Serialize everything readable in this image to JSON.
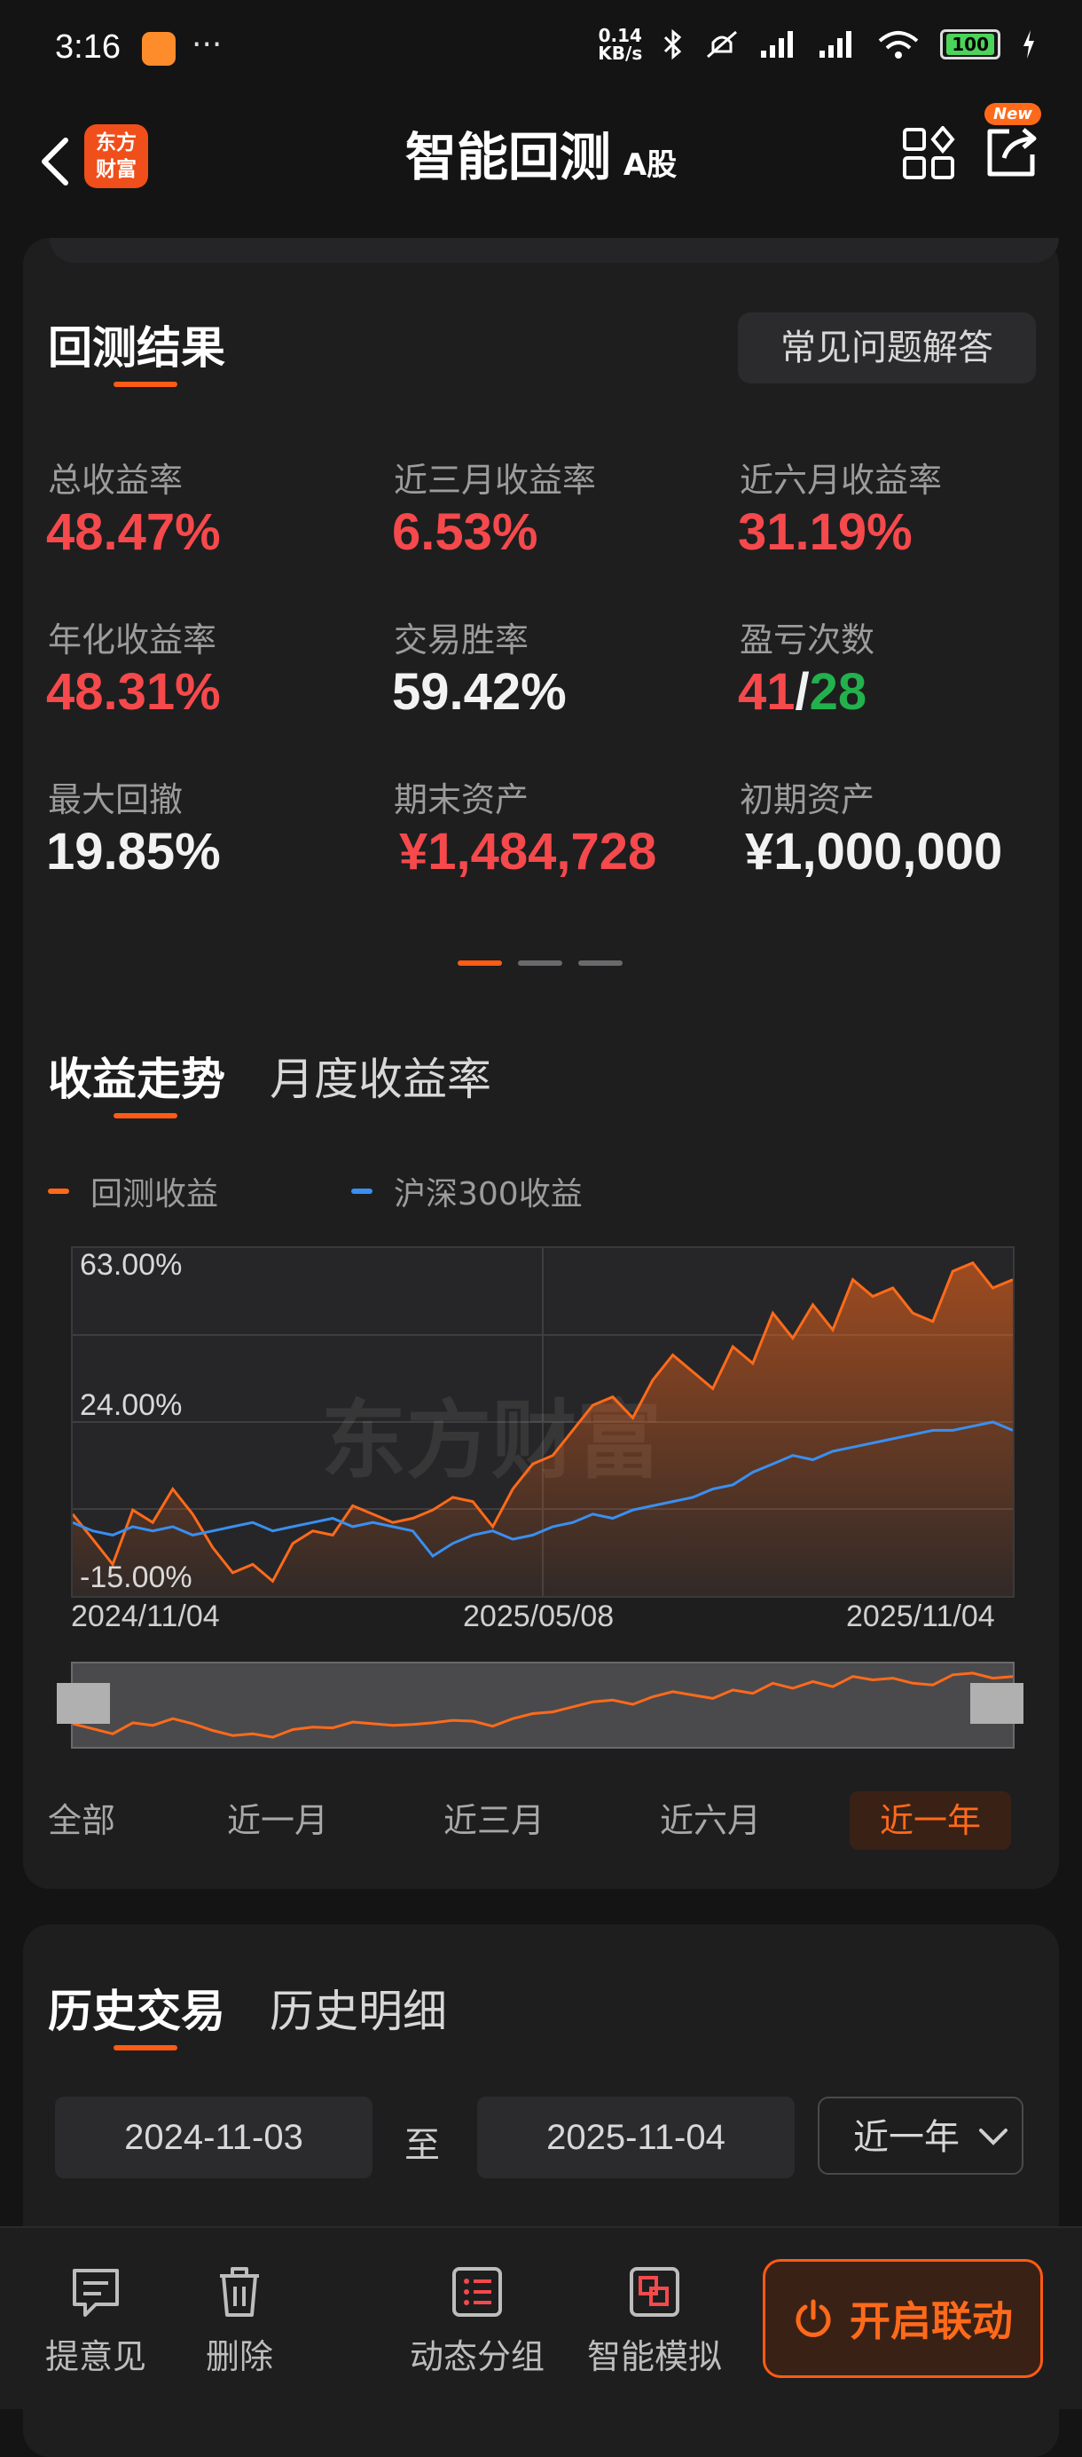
{
  "status": {
    "time": "3:16",
    "dots": "···",
    "net_speed_top": "0.14",
    "net_speed_bottom": "KB/s",
    "battery": "100"
  },
  "header": {
    "title": "智能回测",
    "market": "A股",
    "logo_line1": "东方",
    "logo_line2": "财富",
    "new_badge": "New"
  },
  "results": {
    "title": "回测结果",
    "faq_button": "常见问题解答",
    "metrics": [
      {
        "label": "总收益率",
        "value": "48.47%"
      },
      {
        "label": "近三月收益率",
        "value": "6.53%"
      },
      {
        "label": "近六月收益率",
        "value": "31.19%"
      },
      {
        "label": "年化收益率",
        "value": "48.31%"
      },
      {
        "label": "交易胜率",
        "value": "59.42%"
      },
      {
        "label": "盈亏次数",
        "wins": "41",
        "sep": "/",
        "losses": "28"
      },
      {
        "label": "最大回撤",
        "value": "19.85%"
      },
      {
        "label": "期末资产",
        "value": "¥1,484,728"
      },
      {
        "label": "初期资产",
        "value": "¥1,000,000"
      }
    ]
  },
  "trend": {
    "tab_active": "收益走势",
    "tab_other": "月度收益率",
    "legend": [
      {
        "name": "回测收益",
        "color": "#ff6a1a"
      },
      {
        "name": "沪深300收益",
        "color": "#3a8ff0"
      }
    ],
    "watermark": "东方财富",
    "ranges": [
      "全部",
      "近一月",
      "近三月",
      "近六月",
      "近一年"
    ],
    "active_range": "近一年"
  },
  "chart_data": {
    "type": "line",
    "yticks": [
      "63.00%",
      "24.00%",
      "-15.00%"
    ],
    "xticks": [
      "2024/11/04",
      "2025/05/08",
      "2025/11/04"
    ],
    "ylim": [
      -15,
      63
    ],
    "grid": true,
    "series": [
      {
        "name": "回测收益",
        "color": "#ff6a1a",
        "values": [
          2,
          -4,
          -10,
          3,
          0,
          8,
          2,
          -6,
          -12,
          -10,
          -14,
          -5,
          -2,
          -3,
          4,
          2,
          0,
          1,
          3,
          6,
          5,
          -1,
          8,
          14,
          16,
          22,
          28,
          30,
          25,
          34,
          40,
          36,
          32,
          42,
          38,
          50,
          44,
          52,
          46,
          58,
          54,
          56,
          50,
          48,
          60,
          62,
          56,
          58
        ]
      },
      {
        "name": "沪深300收益",
        "color": "#3a8ff0",
        "values": [
          0,
          -2,
          -3,
          -1,
          -2,
          -1,
          -3,
          -2,
          -1,
          0,
          -2,
          -1,
          0,
          1,
          -1,
          0,
          -1,
          -2,
          -8,
          -5,
          -3,
          -2,
          -4,
          -3,
          -1,
          0,
          2,
          1,
          3,
          4,
          5,
          6,
          8,
          9,
          12,
          14,
          16,
          15,
          17,
          18,
          19,
          20,
          21,
          22,
          22,
          23,
          24,
          22
        ]
      }
    ]
  },
  "history": {
    "tab_active": "历史交易",
    "tab_other": "历史明细",
    "start_date": "2024-11-03",
    "to": "至",
    "end_date": "2025-11-04",
    "period": "近一年"
  },
  "bottom": {
    "items": [
      "提意见",
      "删除",
      "动态分组",
      "智能模拟"
    ],
    "cta": "开启联动"
  }
}
